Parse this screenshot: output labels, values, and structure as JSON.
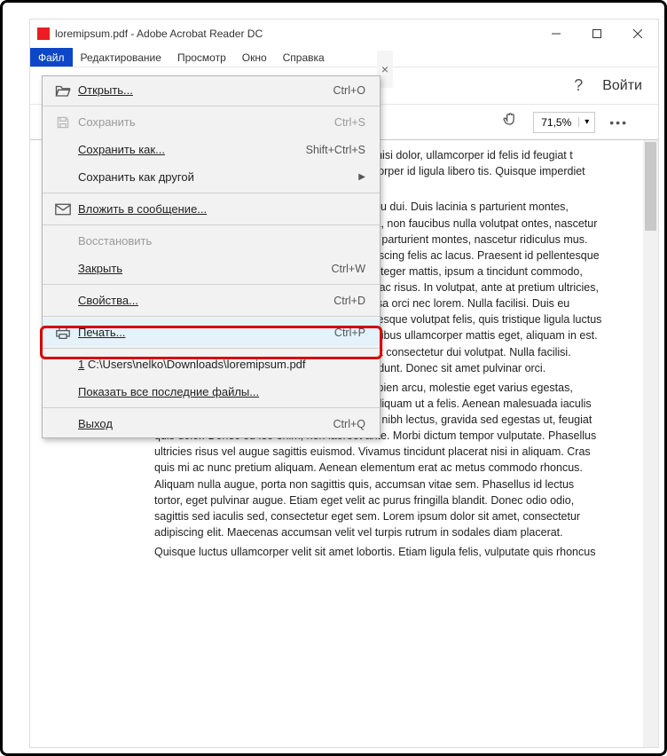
{
  "title": "loremipsum.pdf - Adobe Acrobat Reader DC",
  "menubar": {
    "file": "Файл",
    "edit": "Редактирование",
    "view": "Просмотр",
    "window": "Окно",
    "help": "Справка"
  },
  "toolbar": {
    "help": "?",
    "signin": "Войти",
    "zoom": "71,5%",
    "more": "•••",
    "tab_close": "×"
  },
  "dropdown": {
    "open": {
      "label": "Открыть...",
      "sc": "Ctrl+O"
    },
    "save": {
      "label": "Сохранить",
      "sc": "Ctrl+S"
    },
    "saveas": {
      "label": "Сохранить как...",
      "sc": "Shift+Ctrl+S"
    },
    "saveother": {
      "label": "Сохранить как другой"
    },
    "attach": {
      "label": "Вложить в сообщение..."
    },
    "revert": {
      "label": "Восстановить"
    },
    "close": {
      "label": "Закрыть",
      "sc": "Ctrl+W"
    },
    "props": {
      "label": "Свойства...",
      "sc": "Ctrl+D"
    },
    "print": {
      "label": "Печать...",
      "sc": "Ctrl+P"
    },
    "recent1": {
      "label": "C:\\Users\\nelko\\Downloads\\loremipsum.pdf",
      "n": "1"
    },
    "showall": {
      "label": "Показать все последние файлы..."
    },
    "exit": {
      "label": "Выход",
      "sc": "Ctrl+Q"
    }
  },
  "doc": {
    "p1": "illa est purus, ultrices in porttitor is. Curabitur nisi dolor, ullamcorper id felis id feugiat t lorem. Aliquam porta eros sed n. Nunc ullamcorper id ligula libero tis. Quisque imperdiet ipsum vel tibulum turpis viverra id.",
    "p2": "t blandit metus, ac posuere lorem t, vehicula eu dui. Duis lacinia s parturient montes, nascetur. congue porta. Vivamus viverra ligula, non faucibus nulla volutpat ontes, nascetur ridiculus mus. atoque penatibus et magnis dis parturient montes, nascetur ridiculus mus. Vestibulum vitae ipsum nisi arcu semper adipiscing felis ac lacus. Praesent id pellentesque orci. Morbi congue viverra nisl nec rhoncus. Integer mattis, ipsum a tincidunt commodo, lacus arcu elementum elit, at mollis eros ante ac risus. In volutpat, ante at pretium ultricies, velit magna suscipit enim, aliquet blandit massa orci nec lorem. Nulla facilisi. Duis eu vehicula arcu. Nulla facilisi. Maecenas pellentesque volutpat felis, quis tristique ligula luctus vel. Sed nec mi eros. Integer augue enim, dapibus ullamcorper mattis eget, aliquam in est. Morbi sollicitudin libero nec augue dignissim ut consectetur dui volutpat. Nulla facilisi. Mauris egestas vestibulum neque cursus tincidunt. Donec sit amet pulvinar orci.",
    "p3": "Quisque volutpat pharetra tincidunt. Fusce sapien arcu, molestie eget varius egestas, faucibus ac urna. Sed at nisi in velit egestas aliquam ut a felis. Aenean malesuada iaculis nisl, ut tempor lacus egestas consequat. Nam nibh lectus, gravida sed egestas ut, feugiat quis dolor. Donec eu leo enim, non laoreet ante. Morbi dictum tempor vulputate. Phasellus ultricies risus vel augue sagittis euismod. Vivamus tincidunt placerat nisi in aliquam. Cras quis mi ac nunc pretium aliquam. Aenean elementum erat ac metus commodo rhoncus. Aliquam nulla augue, porta non sagittis quis, accumsan vitae sem. Phasellus id lectus tortor, eget pulvinar augue. Etiam eget velit ac purus fringilla blandit. Donec odio odio, sagittis sed iaculis sed, consectetur eget sem. Lorem ipsum dolor sit amet, consectetur adipiscing elit. Maecenas accumsan velit vel turpis rutrum in sodales diam placerat.",
    "p4": "Quisque luctus ullamcorper velit sit amet lobortis. Etiam ligula felis, vulputate quis rhoncus"
  }
}
